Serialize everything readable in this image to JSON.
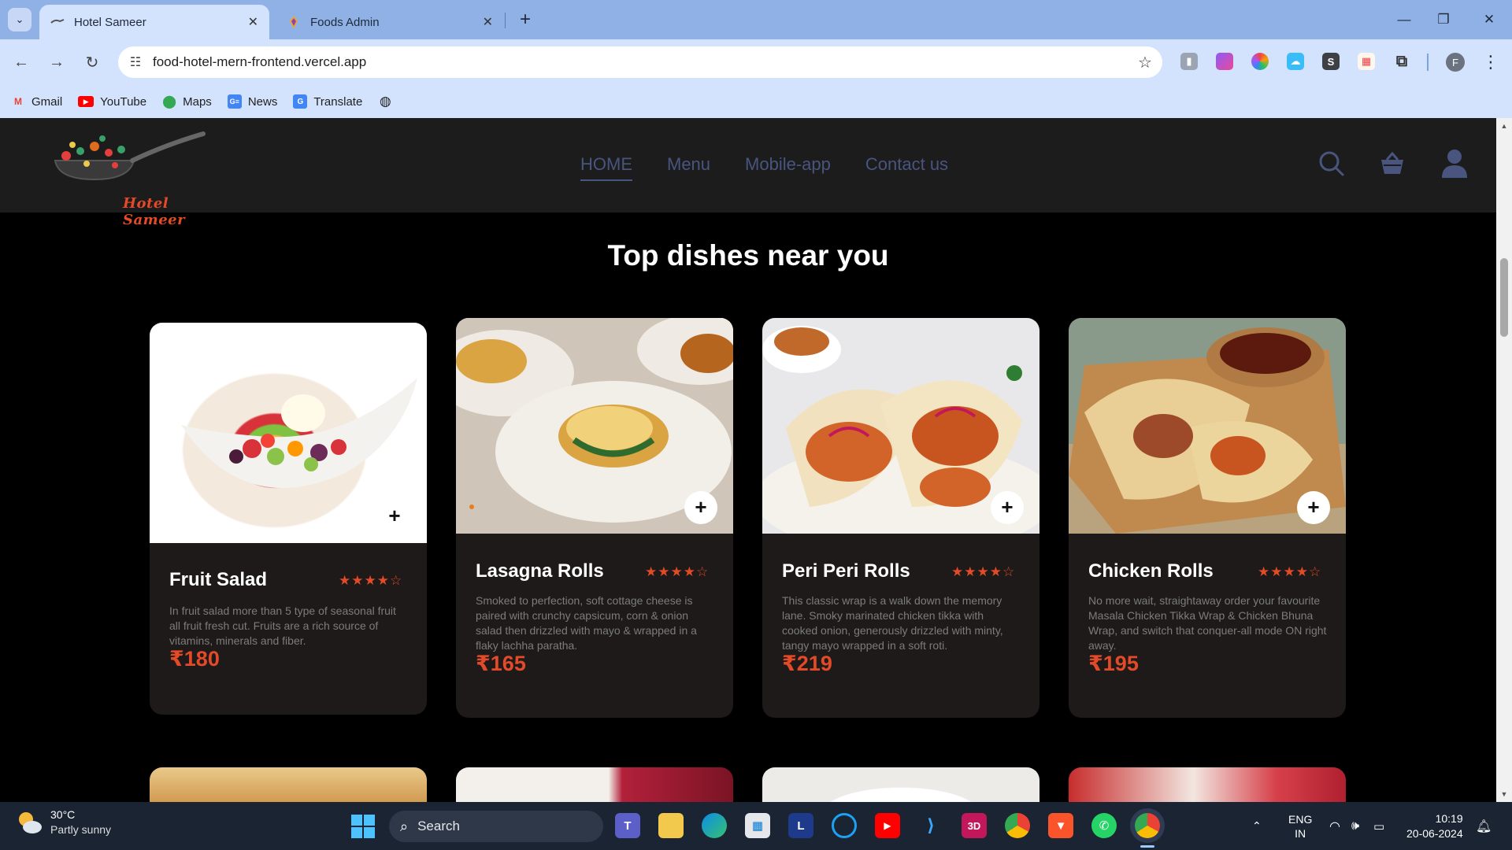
{
  "browser": {
    "tabs": [
      {
        "title": "Hotel Sameer",
        "active": true
      },
      {
        "title": "Foods Admin",
        "active": false
      }
    ],
    "url": "food-hotel-mern-frontend.vercel.app",
    "bookmarks": [
      {
        "label": "Gmail",
        "icon": "gmail-icon"
      },
      {
        "label": "YouTube",
        "icon": "youtube-icon"
      },
      {
        "label": "Maps",
        "icon": "maps-icon"
      },
      {
        "label": "News",
        "icon": "news-icon"
      },
      {
        "label": "Translate",
        "icon": "translate-icon"
      }
    ],
    "profile_initial": "F"
  },
  "site": {
    "logo_text": "Hotel Sameer",
    "menu": [
      {
        "label": "HOME",
        "active": true
      },
      {
        "label": "Menu",
        "active": false
      },
      {
        "label": "Mobile-app",
        "active": false
      },
      {
        "label": "Contact us",
        "active": false
      }
    ],
    "heading": "Top dishes near you",
    "accent_color": "#e24a28",
    "nav_text_color": "#49557e"
  },
  "dishes": [
    {
      "name": "Fruit Salad",
      "rating": 4,
      "rating_max": 5,
      "description": "In fruit salad more than 5 type of seasonal fruit all fruit fresh cut. Fruits are a rich source of vitamins, minerals and fiber.",
      "price": "₹180"
    },
    {
      "name": "Lasagna Rolls",
      "rating": 4,
      "rating_max": 5,
      "description": "Smoked to perfection, soft cottage cheese is paired with crunchy capsicum, corn & onion salad then drizzled with mayo & wrapped in a flaky lachha paratha.",
      "price": "₹165"
    },
    {
      "name": "Peri Peri Rolls",
      "rating": 4,
      "rating_max": 5,
      "description": "This classic wrap is a walk down the memory lane. Smoky marinated chicken tikka with cooked onion, generously drizzled with minty, tangy mayo wrapped in a soft roti.",
      "price": "₹219"
    },
    {
      "name": "Chicken Rolls",
      "rating": 4,
      "rating_max": 5,
      "description": "No more wait, straightaway order your favourite Masala Chicken Tikka Wrap & Chicken Bhuna Wrap, and switch that conquer-all mode ON right away.",
      "price": "₹195"
    }
  ],
  "taskbar": {
    "weather_temp": "30°C",
    "weather_desc": "Partly sunny",
    "search_label": "Search",
    "lang_line1": "ENG",
    "lang_line2": "IN",
    "time": "10:19",
    "date": "20-06-2024"
  }
}
